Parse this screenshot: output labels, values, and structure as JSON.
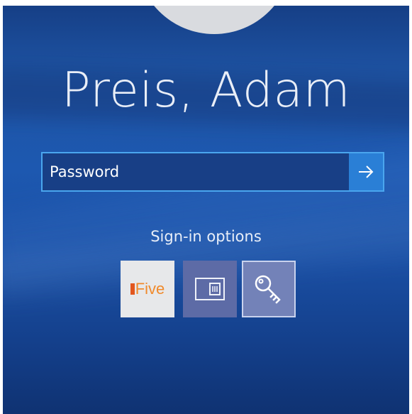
{
  "user": {
    "display_name": "Preis, Adam"
  },
  "password": {
    "placeholder": "Password",
    "value": ""
  },
  "submit": {
    "icon": "arrow-right-icon"
  },
  "signin_options": {
    "label": "Sign-in options",
    "options": [
      {
        "id": "fivebox",
        "logo_text": "Five",
        "icon": "fivebox-logo-icon"
      },
      {
        "id": "smart-card",
        "icon": "smart-card-icon"
      },
      {
        "id": "password-key",
        "icon": "key-icon",
        "selected": true
      }
    ]
  },
  "colors": {
    "background": "#1d58b0",
    "input_border": "#4aa6ee",
    "submit_button": "#2a7fd6",
    "avatar": "#d9dbdf"
  }
}
